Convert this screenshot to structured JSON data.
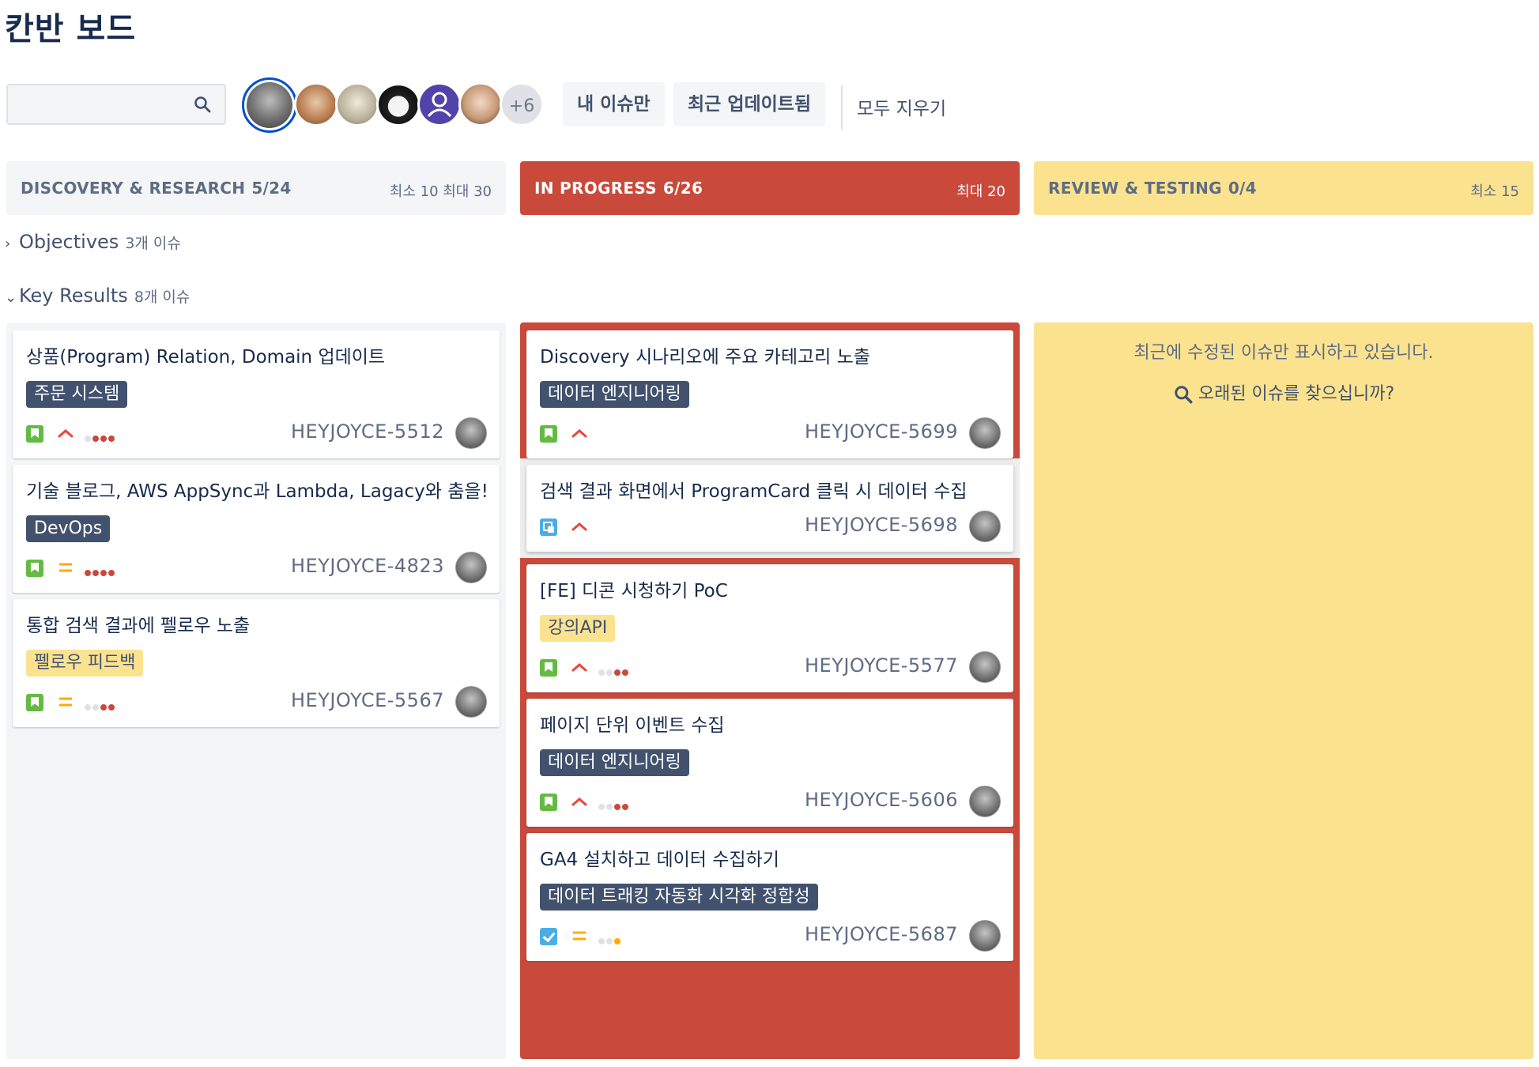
{
  "page": {
    "title": "칸반 보드"
  },
  "toolbar": {
    "search_placeholder": "",
    "avatars_more": "+6",
    "filter_my_issues": "내 이슈만",
    "filter_recent": "최근 업데이트됨",
    "clear_all": "모두 지우기"
  },
  "columns": [
    {
      "title": "DISCOVERY & RESEARCH",
      "count": "5/24",
      "limit": "최소 10  최대 30",
      "color": "#f4f5f7"
    },
    {
      "title": "IN PROGRESS",
      "count": "6/26",
      "limit": "최대 20",
      "color": "#c9493b"
    },
    {
      "title": "REVIEW & TESTING",
      "count": "0/4",
      "limit": "최소 15",
      "color": "#fbe28f"
    }
  ],
  "swimlanes": [
    {
      "name": "Objectives",
      "count": "3개 이슈",
      "icon": "chevron-right"
    },
    {
      "name": "Key Results",
      "count": "8개 이슈",
      "icon": "chevron-down"
    }
  ],
  "discovery_cards": [
    {
      "summary": "상품(Program) Relation, Domain 업데이트",
      "epic": "주문 시스템",
      "key": "HEYJOYCE-5512",
      "type": "story",
      "priority": "high"
    },
    {
      "summary": "기술 블로그, AWS AppSync과 Lambda, Lagacy와 춤을!",
      "epic": "DevOps",
      "key": "HEYJOYCE-4823",
      "type": "story",
      "priority": "medium"
    },
    {
      "summary": "통합 검색 결과에 펠로우 노출",
      "epic": "펠로우 피드백",
      "key": "HEYJOYCE-5567",
      "type": "story",
      "priority": "medium"
    }
  ],
  "progress_cards": [
    {
      "summary": "Discovery 시나리오에 주요 카테고리 노출",
      "epic": "데이터 엔지니어링",
      "key": "HEYJOYCE-5699",
      "type": "story",
      "priority": "high"
    },
    {
      "summary": "검색 결과 화면에서 ProgramCard 클릭 시 데이터 수집",
      "key": "HEYJOYCE-5698",
      "type": "subtask",
      "priority": "high"
    },
    {
      "summary": "[FE] 디콘 시청하기 PoC",
      "epic": "강의API",
      "key": "HEYJOYCE-5577",
      "type": "story",
      "priority": "high"
    },
    {
      "summary": "페이지 단위 이벤트 수집",
      "epic": "데이터 엔지니어링",
      "key": "HEYJOYCE-5606",
      "type": "story",
      "priority": "high"
    },
    {
      "summary": "GA4 설치하고 데이터 수집하기",
      "epic": "데이터 트래킹 자동화 시각화 정합성",
      "key": "HEYJOYCE-5687",
      "type": "task",
      "priority": "medium"
    }
  ],
  "review": {
    "message": "최근에 수정된 이슈만 표시하고 있습니다.",
    "link": "오래된 이슈를 찾으십니까?"
  }
}
